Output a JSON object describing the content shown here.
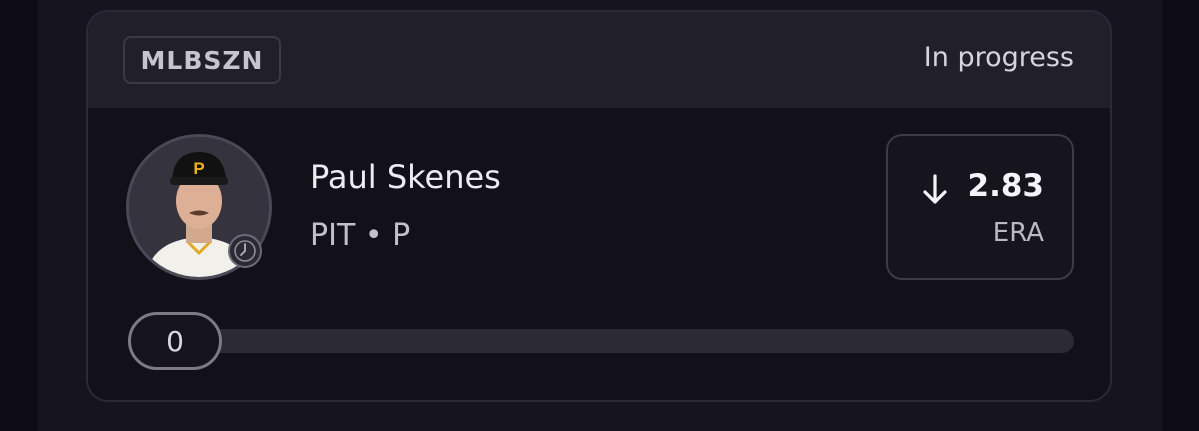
{
  "card": {
    "tag": "MLBSZN",
    "status": "In progress"
  },
  "player": {
    "name": "Paul Skenes",
    "team": "PIT",
    "separator": "•",
    "position": "P",
    "avatar_icon": "player-headshot",
    "badge_icon": "clock-icon"
  },
  "stat": {
    "direction": "down",
    "direction_icon": "arrow-down-icon",
    "value": "2.83",
    "label": "ERA"
  },
  "progress": {
    "value": "0",
    "fraction": 0
  },
  "colors": {
    "background": "#0e0d16",
    "card": "#121119",
    "header": "#201f2a",
    "cap": "#111111",
    "cap_logo": "#f2b21b"
  }
}
